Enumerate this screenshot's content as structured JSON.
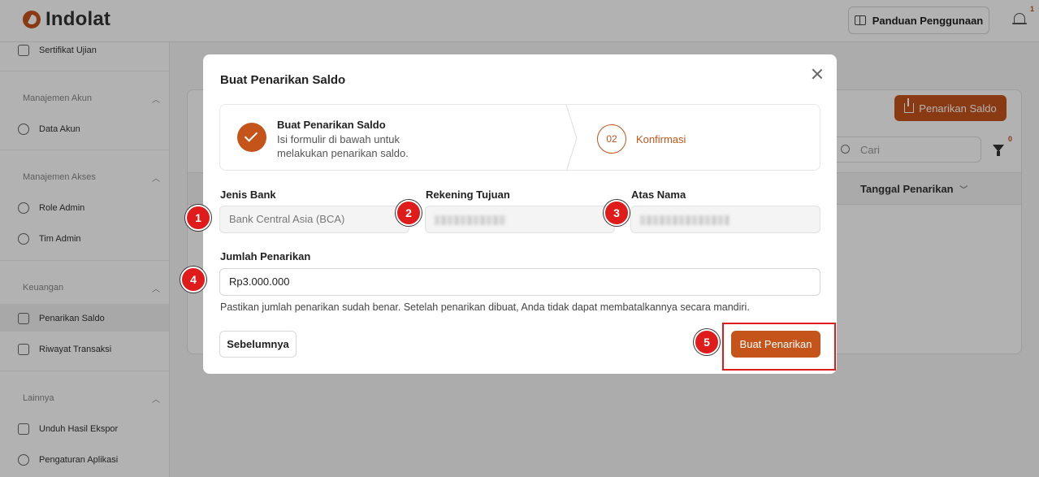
{
  "app": {
    "logo_text": "Indolat",
    "guide_label": "Panduan Penggunaan",
    "notification_count": "1"
  },
  "sidebar": {
    "items": [
      {
        "label": "Sertifikat Ujian"
      },
      {
        "label": "Data Akun"
      },
      {
        "label": "Role Admin"
      },
      {
        "label": "Tim Admin"
      },
      {
        "label": "Penarikan Saldo"
      },
      {
        "label": "Riwayat Transaksi"
      },
      {
        "label": "Unduh Hasil Ekspor"
      },
      {
        "label": "Pengaturan Aplikasi"
      }
    ],
    "sections": [
      "Manajemen Akun",
      "Manajemen Akses",
      "Keuangan",
      "Lainnya"
    ]
  },
  "main": {
    "withdraw_button": "Penarikan Saldo",
    "search_placeholder": "Cari",
    "filter_count": "0",
    "column_date": "Tanggal Penarikan"
  },
  "modal": {
    "title": "Buat Penarikan Saldo",
    "step1": {
      "title": "Buat Penarikan Saldo",
      "desc": "Isi formulir di bawah untuk melakukan penarikan saldo."
    },
    "step2": {
      "number": "02",
      "title": "Konfirmasi"
    },
    "fields": {
      "bank_label": "Jenis Bank",
      "bank_value": "Bank Central Asia (BCA)",
      "account_label": "Rekening Tujuan",
      "name_label": "Atas Nama",
      "amount_label": "Jumlah Penarikan",
      "amount_value": "Rp3.000.000"
    },
    "hint": "Pastikan jumlah penarikan sudah benar. Setelah penarikan dibuat, Anda tidak dapat membatalkannya secara mandiri.",
    "prev_button": "Sebelumnya",
    "submit_button": "Buat Penarikan"
  },
  "markers": [
    "1",
    "2",
    "3",
    "4",
    "5"
  ],
  "colors": {
    "accent": "#c4541a",
    "annotation": "#e01b1b"
  }
}
